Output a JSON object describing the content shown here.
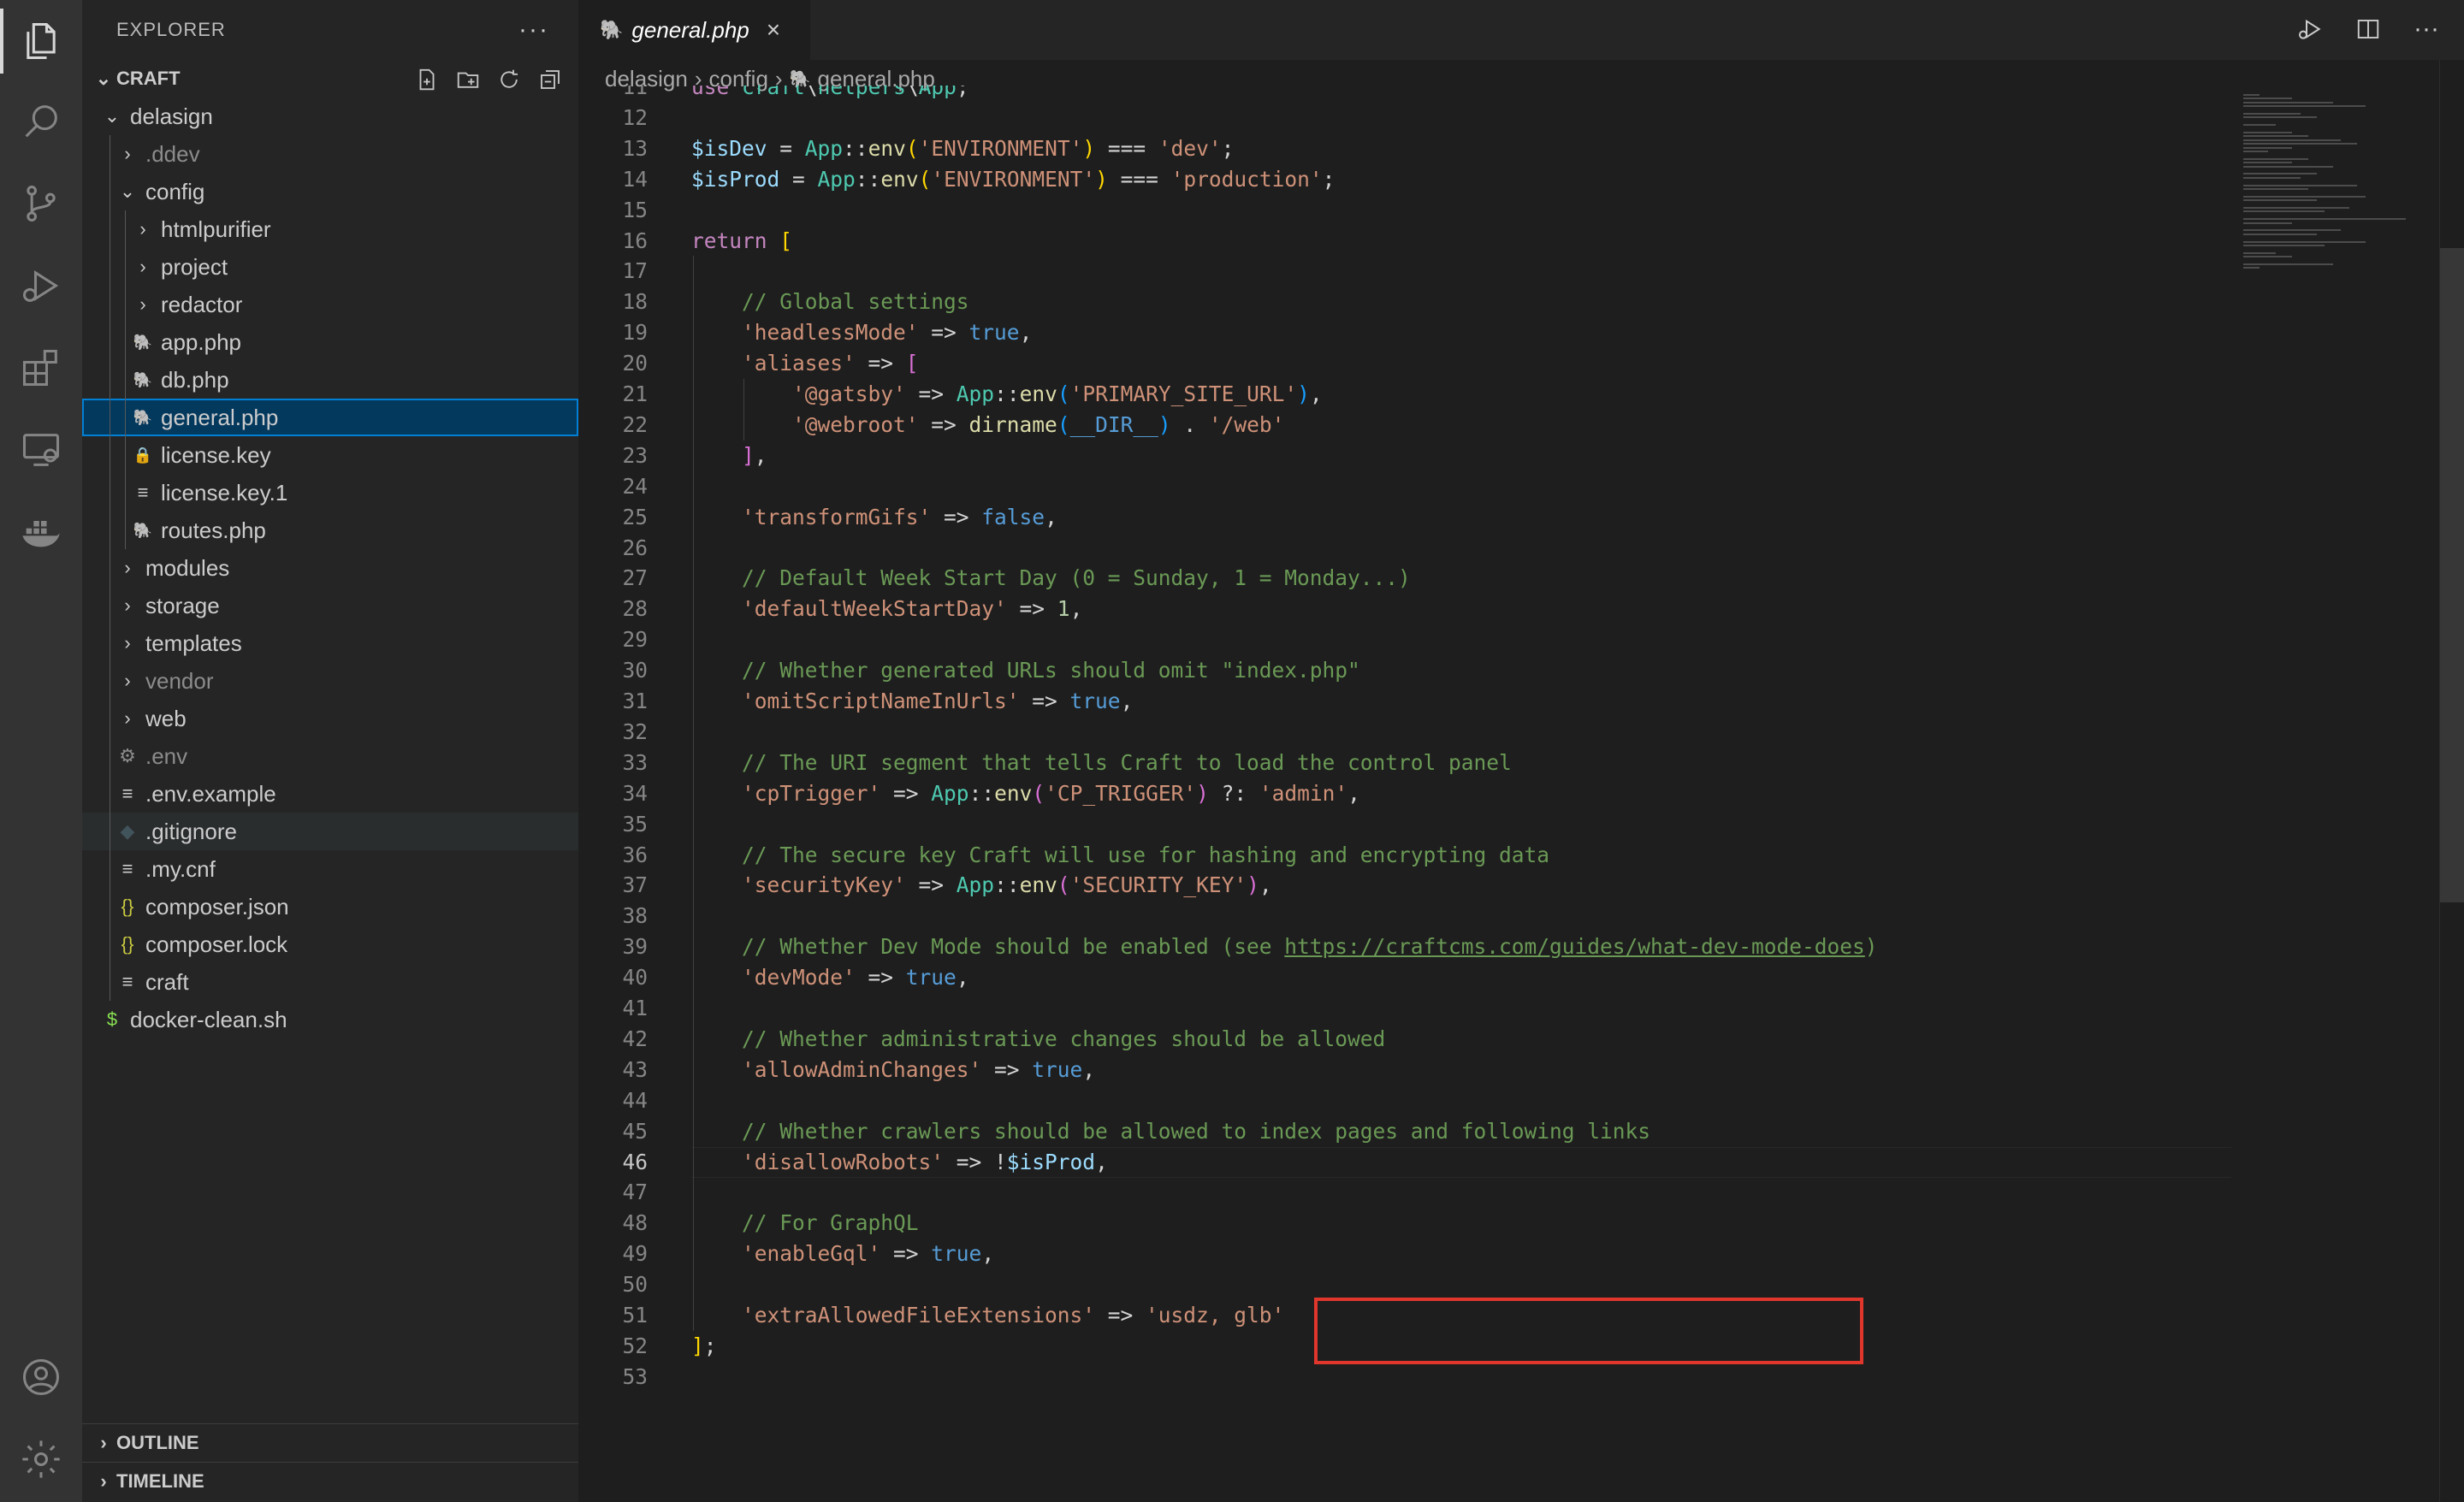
{
  "sidebar": {
    "title": "EXPLORER",
    "more": "···",
    "root": "CRAFT",
    "tree": [
      {
        "label": "delasign",
        "icon": "chevron-down",
        "indent": 0,
        "dim": false
      },
      {
        "label": ".ddev",
        "icon": "chevron-right",
        "indent": 1,
        "dim": true
      },
      {
        "label": "config",
        "icon": "chevron-down",
        "indent": 1,
        "dim": false
      },
      {
        "label": "htmlpurifier",
        "icon": "chevron-right",
        "indent": 2,
        "dim": false
      },
      {
        "label": "project",
        "icon": "chevron-right",
        "indent": 2,
        "dim": false
      },
      {
        "label": "redactor",
        "icon": "chevron-right",
        "indent": 2,
        "dim": false
      },
      {
        "label": "app.php",
        "icon": "php",
        "indent": 2,
        "dim": false
      },
      {
        "label": "db.php",
        "icon": "php",
        "indent": 2,
        "dim": false
      },
      {
        "label": "general.php",
        "icon": "php",
        "indent": 2,
        "dim": false,
        "selected": true
      },
      {
        "label": "license.key",
        "icon": "lock",
        "indent": 2,
        "dim": false
      },
      {
        "label": "license.key.1",
        "icon": "lines",
        "indent": 2,
        "dim": false
      },
      {
        "label": "routes.php",
        "icon": "php",
        "indent": 2,
        "dim": false
      },
      {
        "label": "modules",
        "icon": "chevron-right",
        "indent": 1,
        "dim": false
      },
      {
        "label": "storage",
        "icon": "chevron-right",
        "indent": 1,
        "dim": false
      },
      {
        "label": "templates",
        "icon": "chevron-right",
        "indent": 1,
        "dim": false
      },
      {
        "label": "vendor",
        "icon": "chevron-right",
        "indent": 1,
        "dim": true
      },
      {
        "label": "web",
        "icon": "chevron-right",
        "indent": 1,
        "dim": false
      },
      {
        "label": ".env",
        "icon": "gear",
        "indent": 1,
        "dim": true
      },
      {
        "label": ".env.example",
        "icon": "lines",
        "indent": 1,
        "dim": false
      },
      {
        "label": ".gitignore",
        "icon": "git",
        "indent": 1,
        "dim": false,
        "hover": true
      },
      {
        "label": ".my.cnf",
        "icon": "lines",
        "indent": 1,
        "dim": false
      },
      {
        "label": "composer.json",
        "icon": "braces",
        "indent": 1,
        "dim": false
      },
      {
        "label": "composer.lock",
        "icon": "braces",
        "indent": 1,
        "dim": false
      },
      {
        "label": "craft",
        "icon": "lines",
        "indent": 1,
        "dim": false
      },
      {
        "label": "docker-clean.sh",
        "icon": "dollar",
        "indent": 0,
        "dim": false
      }
    ],
    "outline": "OUTLINE",
    "timeline": "TIMELINE"
  },
  "tab": {
    "label": "general.php",
    "close": "×"
  },
  "breadcrumb": [
    "delasign",
    "config",
    "general.php"
  ],
  "code": {
    "current_line": 46,
    "lines": [
      {
        "n": 11,
        "html": "<span class='kw'>use</span> <span class='cls'>craft</span>\\<span class='cls'>helpers</span>\\<span class='cls'>App</span>;"
      },
      {
        "n": 12,
        "html": ""
      },
      {
        "n": 13,
        "html": "<span class='var'>$isDev</span> = <span class='cls'>App</span>::<span class='fn'>env</span><span class='br'>(</span><span class='str'>'ENVIRONMENT'</span><span class='br'>)</span> === <span class='str'>'dev'</span>;"
      },
      {
        "n": 14,
        "html": "<span class='var'>$isProd</span> = <span class='cls'>App</span>::<span class='fn'>env</span><span class='br'>(</span><span class='str'>'ENVIRONMENT'</span><span class='br'>)</span> === <span class='str'>'production'</span>;"
      },
      {
        "n": 15,
        "html": ""
      },
      {
        "n": 16,
        "html": "<span class='kw'>return</span> <span class='br'>[</span>"
      },
      {
        "n": 17,
        "html": ""
      },
      {
        "n": 18,
        "html": "    <span class='cm'>// Global settings</span>"
      },
      {
        "n": 19,
        "html": "    <span class='str'>'headlessMode'</span> => <span class='kw2'>true</span>,"
      },
      {
        "n": 20,
        "html": "    <span class='str'>'aliases'</span> => <span class='br2'>[</span>"
      },
      {
        "n": 21,
        "html": "        <span class='str'>'@gatsby'</span> => <span class='cls'>App</span>::<span class='fn'>env</span><span class='br3'>(</span><span class='str'>'PRIMARY_SITE_URL'</span><span class='br3'>)</span>,"
      },
      {
        "n": 22,
        "html": "        <span class='str'>'@webroot'</span> => <span class='fn'>dirname</span><span class='br3'>(</span><span class='kw2'>__DIR__</span><span class='br3'>)</span> . <span class='str'>'/web'</span>"
      },
      {
        "n": 23,
        "html": "    <span class='br2'>]</span>,"
      },
      {
        "n": 24,
        "html": ""
      },
      {
        "n": 25,
        "html": "    <span class='str'>'transformGifs'</span> => <span class='kw2'>false</span>,"
      },
      {
        "n": 26,
        "html": ""
      },
      {
        "n": 27,
        "html": "    <span class='cm'>// Default Week Start Day (0 = Sunday, 1 = Monday...)</span>"
      },
      {
        "n": 28,
        "html": "    <span class='str'>'defaultWeekStartDay'</span> => <span class='num'>1</span>,"
      },
      {
        "n": 29,
        "html": ""
      },
      {
        "n": 30,
        "html": "    <span class='cm'>// Whether generated URLs should omit \"index.php\"</span>"
      },
      {
        "n": 31,
        "html": "    <span class='str'>'omitScriptNameInUrls'</span> => <span class='kw2'>true</span>,"
      },
      {
        "n": 32,
        "html": ""
      },
      {
        "n": 33,
        "html": "    <span class='cm'>// The URI segment that tells Craft to load the control panel</span>"
      },
      {
        "n": 34,
        "html": "    <span class='str'>'cpTrigger'</span> => <span class='cls'>App</span>::<span class='fn'>env</span><span class='br2'>(</span><span class='str'>'CP_TRIGGER'</span><span class='br2'>)</span> ?: <span class='str'>'admin'</span>,"
      },
      {
        "n": 35,
        "html": ""
      },
      {
        "n": 36,
        "html": "    <span class='cm'>// The secure key Craft will use for hashing and encrypting data</span>"
      },
      {
        "n": 37,
        "html": "    <span class='str'>'securityKey'</span> => <span class='cls'>App</span>::<span class='fn'>env</span><span class='br2'>(</span><span class='str'>'SECURITY_KEY'</span><span class='br2'>)</span>,"
      },
      {
        "n": 38,
        "html": ""
      },
      {
        "n": 39,
        "html": "    <span class='cm'>// Whether Dev Mode should be enabled (see <span class='link'>https://craftcms.com/guides/what-dev-mode-does</span>)</span>"
      },
      {
        "n": 40,
        "html": "    <span class='str'>'devMode'</span> => <span class='kw2'>true</span>,"
      },
      {
        "n": 41,
        "html": ""
      },
      {
        "n": 42,
        "html": "    <span class='cm'>// Whether administrative changes should be allowed</span>"
      },
      {
        "n": 43,
        "html": "    <span class='str'>'allowAdminChanges'</span> => <span class='kw2'>true</span>,"
      },
      {
        "n": 44,
        "html": ""
      },
      {
        "n": 45,
        "html": "    <span class='cm'>// Whether crawlers should be allowed to index pages and following links</span>"
      },
      {
        "n": 46,
        "html": "    <span class='str'>'disallowRobots'</span> => !<span class='var'>$isProd</span>,"
      },
      {
        "n": 47,
        "html": ""
      },
      {
        "n": 48,
        "html": "    <span class='cm'>// For GraphQL</span>"
      },
      {
        "n": 49,
        "html": "    <span class='str'>'enableGql'</span> => <span class='kw2'>true</span>,"
      },
      {
        "n": 50,
        "html": ""
      },
      {
        "n": 51,
        "html": "    <span class='str'>'extraAllowedFileExtensions'</span> => <span class='str'>'usdz, glb'</span>"
      },
      {
        "n": 52,
        "html": "<span class='br'>]</span>;"
      },
      {
        "n": 53,
        "html": ""
      }
    ]
  },
  "colors": {
    "highlight_box": "#e0362c",
    "selection": "#04395e",
    "php_icon": "#a074c4"
  }
}
